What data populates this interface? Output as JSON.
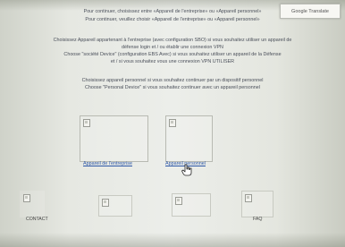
{
  "toolbar": {
    "translate_label": "Google Translate"
  },
  "intro": {
    "line1": "Pour continuer, choisissez entre «Appareil de l'entreprise» ou «Appareil personnel»",
    "line2": "Pour continuer, veuillez choisir «Appareil de l'entreprise» ou «Appareil personnel»"
  },
  "company_info": {
    "line1": "Choisissez Appareil appartenant à l'entreprise (avec configuration SBO) si vous souhaitez utiliser un appareil de",
    "line2": "défense login et / ou établir une connexion VPN",
    "line3": "Choose \"société Device\" (configuration EBS Avec) si vous souhaitez utiliser un appareil de la Défense",
    "line4": "et / si vous souhaitez vous une connexion VPN UTILISER"
  },
  "personal_info": {
    "line1": "Choisissez appareil personnel si vous souhaitez continuer par un dispositif personnel",
    "line2": "Choose \"Personal Device\" si vous souhaitez continuer avec un appareil personnel"
  },
  "options": {
    "company_link": "Appareil de l'entreprise",
    "personal_link": "Appareil personnel"
  },
  "footer": {
    "contact_label": "CONTACT",
    "faq_label": "FAQ"
  }
}
